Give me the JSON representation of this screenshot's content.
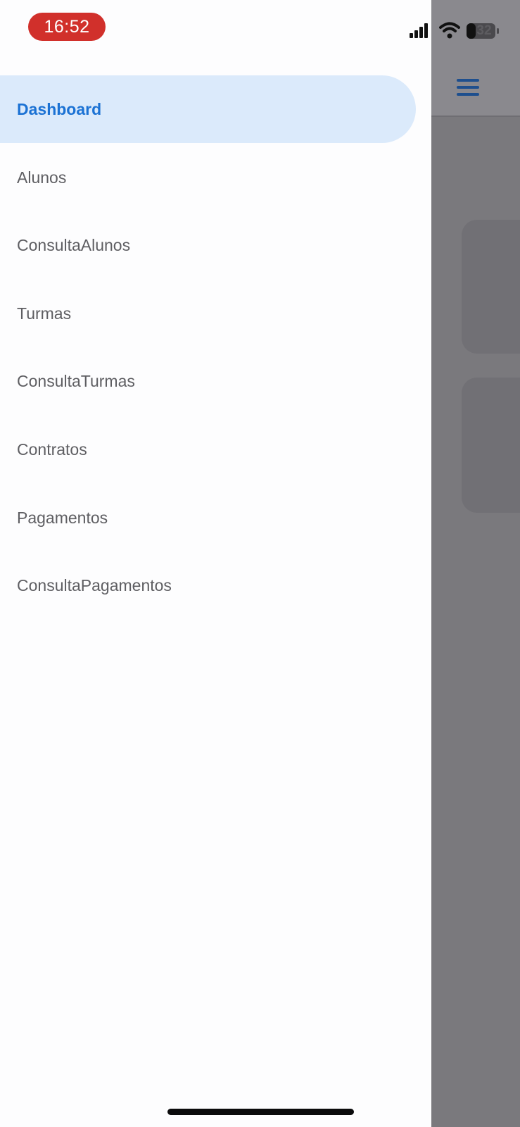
{
  "status_bar": {
    "time": "16:52",
    "battery_level": "32",
    "signal_icon": "signal-bars-icon",
    "wifi_icon": "wifi-icon",
    "battery_icon": "battery-icon"
  },
  "colors": {
    "accent": "#1b72d4",
    "active_item_bg": "#dbeafb",
    "scrim": "#7a797d",
    "time_pill": "#d1302b"
  },
  "drawer": {
    "items": [
      {
        "label": "Dashboard",
        "active": true
      },
      {
        "label": "Alunos",
        "active": false
      },
      {
        "label": "ConsultaAlunos",
        "active": false
      },
      {
        "label": "Turmas",
        "active": false
      },
      {
        "label": "ConsultaTurmas",
        "active": false
      },
      {
        "label": "Contratos",
        "active": false
      },
      {
        "label": "Pagamentos",
        "active": false
      },
      {
        "label": "ConsultaPagamentos",
        "active": false
      }
    ]
  },
  "background_app": {
    "menu_icon": "hamburger-menu-icon"
  }
}
